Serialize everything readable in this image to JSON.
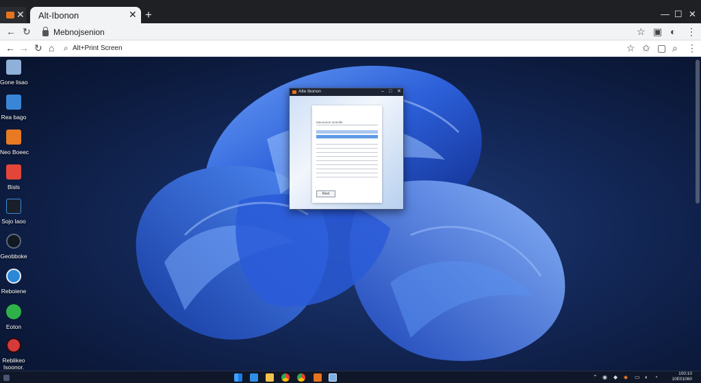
{
  "browser": {
    "tab_title": "Alt-Ibonon",
    "address_bar": "Mebnojsenion",
    "secondary_bar": "Alt+Print Screen"
  },
  "desktop_icons": [
    {
      "label": "Gone lisao",
      "color": "#8fb0d8",
      "icon": "recycle-bin-icon"
    },
    {
      "label": "Rea bago",
      "color": "#3a86d6",
      "icon": "computer-icon"
    },
    {
      "label": "Neo Boeec",
      "color": "#e87a24",
      "icon": "app-orange-icon"
    },
    {
      "label": "Bisls",
      "color": "#e2463a",
      "icon": "app-red-icon"
    },
    {
      "label": "Sojo laoo",
      "color": "#1a1f2a",
      "icon": "app-dark-icon"
    },
    {
      "label": "Geobboke",
      "color": "#111820",
      "icon": "app-black-icon"
    },
    {
      "label": "Reboiene",
      "color": "#2b87d8",
      "icon": "safari-icon"
    },
    {
      "label": "Eoton",
      "color": "#2fb14a",
      "icon": "whatsapp-icon"
    },
    {
      "label": "Reblikeo\nIsoonor.",
      "color": "#d43a3a",
      "icon": "app-red-circle-icon"
    }
  ],
  "popup": {
    "title": "Alte Ibonon",
    "doc_header": "Ianooonon     Ioonolle",
    "button": "Rest"
  },
  "taskbar": {
    "clock_time": "100:10",
    "clock_date": "10E01060"
  }
}
